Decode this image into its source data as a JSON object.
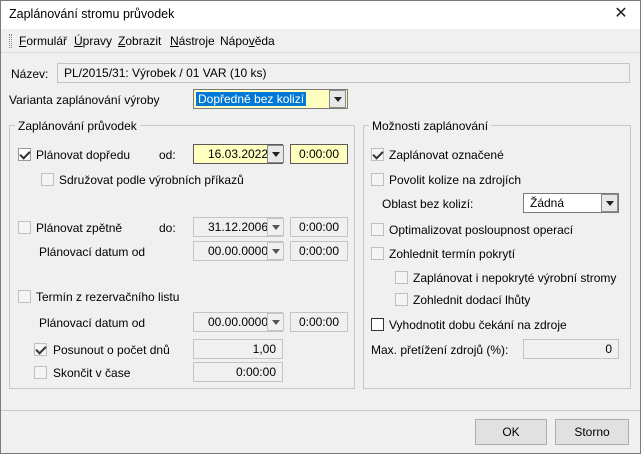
{
  "window": {
    "title": "Zaplánování stromu průvodek",
    "close_glyph": "✕"
  },
  "menu": [
    {
      "pre": "",
      "u": "F",
      "post": "ormulář"
    },
    {
      "pre": "",
      "u": "Ú",
      "post": "pravy"
    },
    {
      "pre": "",
      "u": "Z",
      "post": "obrazit"
    },
    {
      "pre": "",
      "u": "N",
      "post": "ástroje"
    },
    {
      "pre": "Nápo",
      "u": "v",
      "post": "ěda"
    }
  ],
  "nazev": {
    "label": "Název:",
    "value": "PL/2015/31: Výrobek / 01 VAR (10 ks)"
  },
  "varianta": {
    "label": "Varianta zaplánování výroby",
    "value": "Dopředně bez kolizí"
  },
  "left_group": {
    "title": "Zaplánování průvodek",
    "planovat_dopredu": {
      "label": "Plánovat dopředu",
      "checked": true,
      "od_label": "od:",
      "date": "16.03.2022",
      "time": "0:00:00"
    },
    "sdruzovat": {
      "label": "Sdružovat podle výrobních příkazů",
      "checked": false
    },
    "planovat_zpetne": {
      "label": "Plánovat zpětně",
      "checked": false,
      "do_label": "do:",
      "date": "31.12.2006",
      "time": "0:00:00"
    },
    "planovaci_datum_1": {
      "label": "Plánovací datum od",
      "date": "00.00.0000",
      "time": "0:00:00"
    },
    "termin": {
      "label": "Termín z rezervačního listu",
      "checked": false
    },
    "planovaci_datum_2": {
      "label": "Plánovací datum od",
      "date": "00.00.0000",
      "time": "0:00:00"
    },
    "posunout": {
      "label": "Posunout o počet dnů",
      "checked": true,
      "value": "1,00"
    },
    "skoncit": {
      "label": "Skončit v čase",
      "checked": false,
      "value": "0:00:00"
    }
  },
  "right_group": {
    "title": "Možnosti zaplánování",
    "zaplanovat_oznacene": {
      "label": "Zaplánovat označené",
      "checked": true
    },
    "povolit_kolize": {
      "label": "Povolit kolize na zdrojích",
      "checked": false
    },
    "oblast": {
      "label": "Oblast bez kolizí:",
      "value": "Žádná"
    },
    "optimalizovat": {
      "label": "Optimalizovat posloupnost operací",
      "checked": false
    },
    "zohlednit_termin": {
      "label": "Zohlednit termín pokrytí",
      "checked": false
    },
    "zaplanovat_nepokryte": {
      "label": "Zaplánovat i nepokryté výrobní stromy",
      "checked": false
    },
    "zohlednit_dodaci": {
      "label": "Zohlednit dodací lhůty",
      "checked": false
    },
    "vyhodnotit": {
      "label": "Vyhodnotit dobu čekání na zdroje",
      "checked": false
    },
    "max_pretizeni": {
      "label": "Max. přetížení zdrojů (%):",
      "value": "0"
    }
  },
  "buttons": {
    "ok": "OK",
    "storno": "Storno"
  }
}
